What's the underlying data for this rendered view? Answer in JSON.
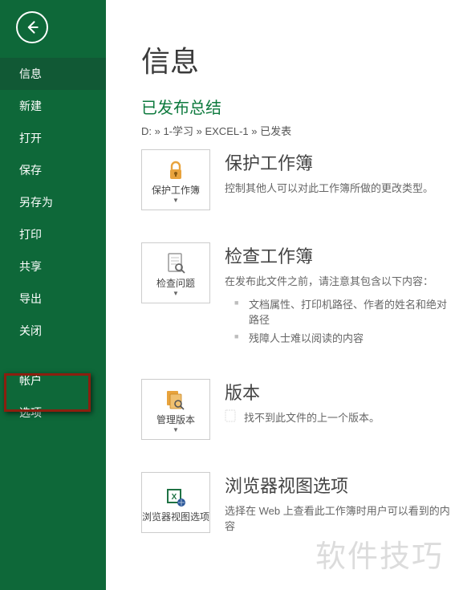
{
  "sidebar": {
    "items": [
      {
        "label": "信息",
        "active": true
      },
      {
        "label": "新建"
      },
      {
        "label": "打开"
      },
      {
        "label": "保存"
      },
      {
        "label": "另存为"
      },
      {
        "label": "打印"
      },
      {
        "label": "共享"
      },
      {
        "label": "导出"
      },
      {
        "label": "关闭"
      }
    ],
    "bottom": [
      {
        "label": "帐户"
      },
      {
        "label": "选项",
        "highlighted": true
      }
    ]
  },
  "main": {
    "title": "信息",
    "fileName": "已发布总结",
    "breadcrumb": "D: » 1-学习 » EXCEL-1 » 已发表",
    "sections": {
      "protect": {
        "tileLabel": "保护工作簿",
        "title": "保护工作簿",
        "desc": "控制其他人可以对此工作簿所做的更改类型。"
      },
      "inspect": {
        "tileLabel": "检查问题",
        "title": "检查工作簿",
        "desc": "在发布此文件之前，请注意其包含以下内容：",
        "bullets": [
          "文档属性、打印机路径、作者的姓名和绝对路径",
          "残障人士难以阅读的内容"
        ]
      },
      "versions": {
        "tileLabel": "管理版本",
        "title": "版本",
        "desc": "找不到此文件的上一个版本。"
      },
      "browser": {
        "tileLabel": "浏览器视图选项",
        "title": "浏览器视图选项",
        "desc": "选择在 Web 上查看此工作簿时用户可以看到的内容"
      }
    }
  },
  "watermark": "软件技巧",
  "colors": {
    "sidebarBg": "#0e6839",
    "accent": "#0e7a3e",
    "highlight": "#8b1f0f"
  }
}
